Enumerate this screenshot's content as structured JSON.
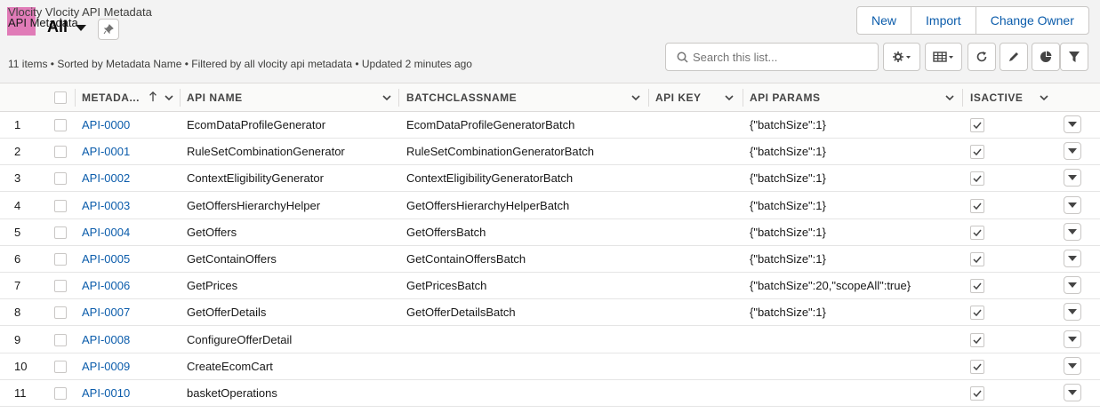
{
  "header": {
    "object_title": "Vlocity Vlocity API Metadata",
    "icon_text": "API Metadata",
    "list_view_name": "All",
    "summary": "11 items • Sorted by Metadata Name • Filtered by all vlocity api metadata • Updated 2 minutes ago",
    "icon_color": "#e07bb7"
  },
  "actions": {
    "new_label": "New",
    "import_label": "Import",
    "change_owner_label": "Change Owner"
  },
  "search": {
    "placeholder": "Search this list..."
  },
  "toolbar": {
    "icons": [
      "gear-icon",
      "table-view-icon",
      "refresh-icon",
      "edit-icon",
      "chart-icon",
      "filter-icon"
    ]
  },
  "table": {
    "columns": {
      "name": "METADA...",
      "api_name": "API NAME",
      "batch": "BATCHCLASSNAME",
      "api_key": "API KEY",
      "api_params": "API PARAMS",
      "isactive": "ISACTIVE"
    },
    "rows": [
      {
        "num": "1",
        "name": "API-0000",
        "api_name": "EcomDataProfileGenerator",
        "batch": "EcomDataProfileGeneratorBatch",
        "api_key": "",
        "api_params": "{\"batchSize\":1}",
        "active": true
      },
      {
        "num": "2",
        "name": "API-0001",
        "api_name": "RuleSetCombinationGenerator",
        "batch": "RuleSetCombinationGeneratorBatch",
        "api_key": "",
        "api_params": "{\"batchSize\":1}",
        "active": true
      },
      {
        "num": "3",
        "name": "API-0002",
        "api_name": "ContextEligibilityGenerator",
        "batch": "ContextEligibilityGeneratorBatch",
        "api_key": "",
        "api_params": "{\"batchSize\":1}",
        "active": true
      },
      {
        "num": "4",
        "name": "API-0003",
        "api_name": "GetOffersHierarchyHelper",
        "batch": "GetOffersHierarchyHelperBatch",
        "api_key": "",
        "api_params": "{\"batchSize\":1}",
        "active": true
      },
      {
        "num": "5",
        "name": "API-0004",
        "api_name": "GetOffers",
        "batch": "GetOffersBatch",
        "api_key": "",
        "api_params": "{\"batchSize\":1}",
        "active": true
      },
      {
        "num": "6",
        "name": "API-0005",
        "api_name": "GetContainOffers",
        "batch": "GetContainOffersBatch",
        "api_key": "",
        "api_params": "{\"batchSize\":1}",
        "active": true
      },
      {
        "num": "7",
        "name": "API-0006",
        "api_name": "GetPrices",
        "batch": "GetPricesBatch",
        "api_key": "",
        "api_params": "{\"batchSize\":20,\"scopeAll\":true}",
        "active": true
      },
      {
        "num": "8",
        "name": "API-0007",
        "api_name": "GetOfferDetails",
        "batch": "GetOfferDetailsBatch",
        "api_key": "",
        "api_params": "{\"batchSize\":1}",
        "active": true
      },
      {
        "num": "9",
        "name": "API-0008",
        "api_name": "ConfigureOfferDetail",
        "batch": "",
        "api_key": "",
        "api_params": "",
        "active": true
      },
      {
        "num": "10",
        "name": "API-0009",
        "api_name": "CreateEcomCart",
        "batch": "",
        "api_key": "",
        "api_params": "",
        "active": true
      },
      {
        "num": "11",
        "name": "API-0010",
        "api_name": "basketOperations",
        "batch": "",
        "api_key": "",
        "api_params": "",
        "active": true
      }
    ]
  }
}
